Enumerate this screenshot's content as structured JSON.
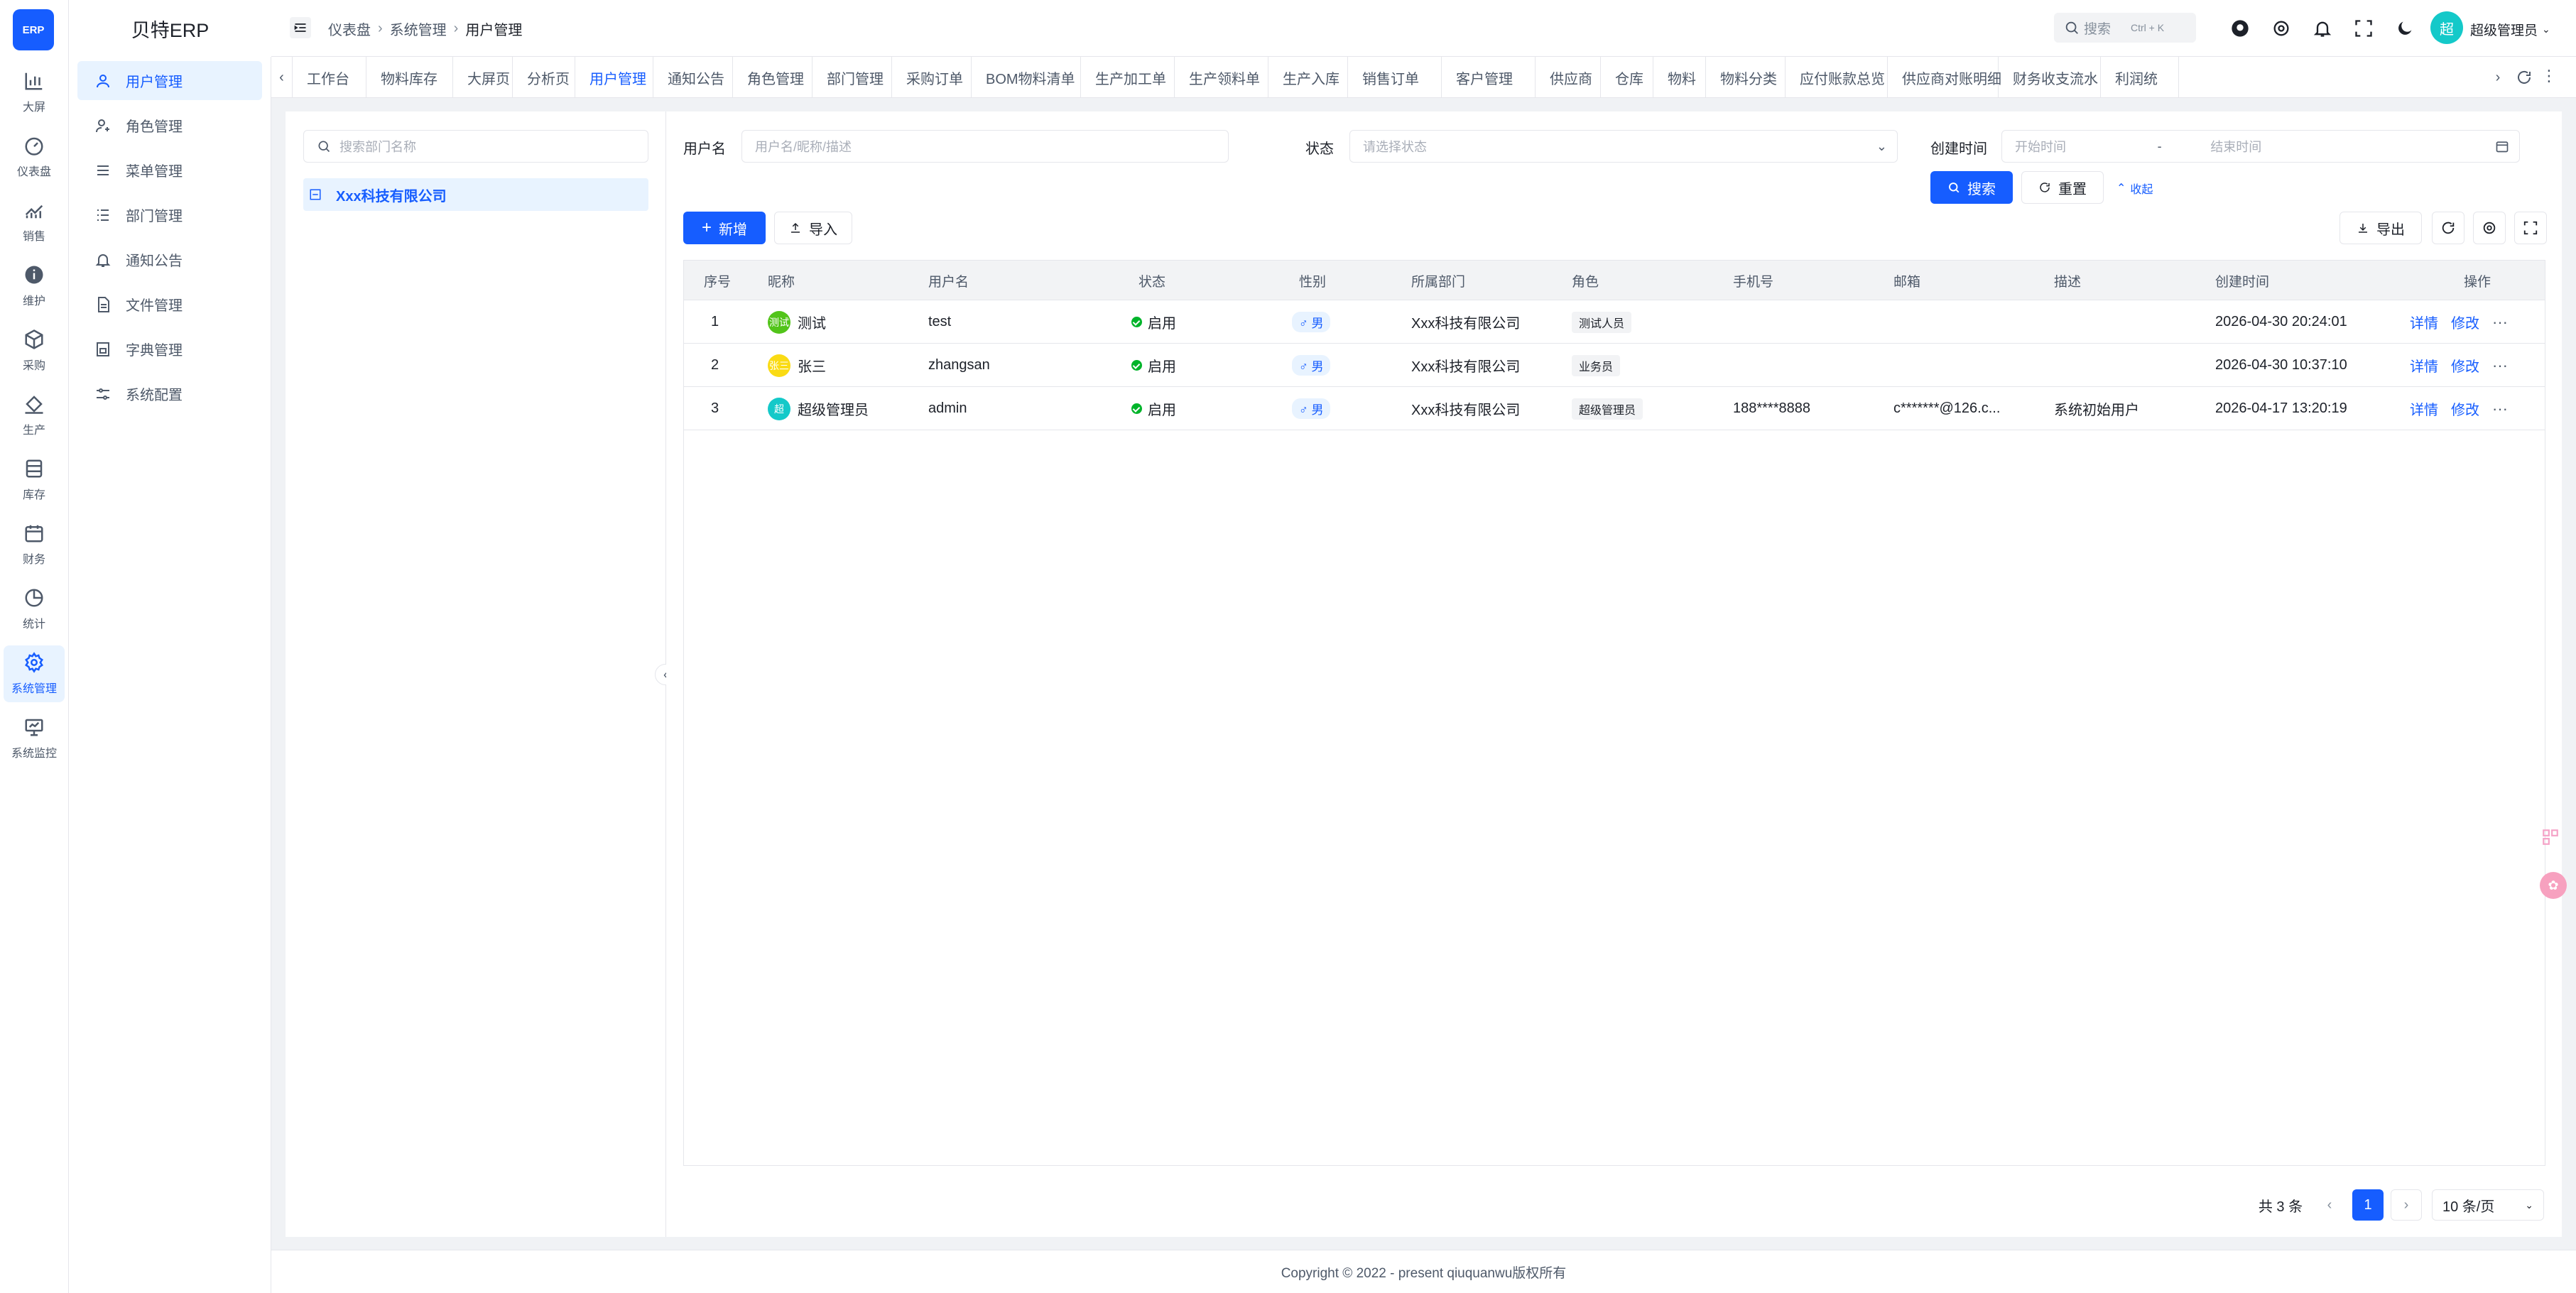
{
  "app": {
    "logo_text": "ERP",
    "title": "贝特ERP"
  },
  "rail": [
    {
      "label": "大屏",
      "icon": "bar-chart-icon"
    },
    {
      "label": "仪表盘",
      "icon": "dashboard-icon"
    },
    {
      "label": "销售",
      "icon": "trend-icon"
    },
    {
      "label": "维护",
      "icon": "info-icon"
    },
    {
      "label": "采购",
      "icon": "cube-icon"
    },
    {
      "label": "生产",
      "icon": "paint-bucket-icon"
    },
    {
      "label": "库存",
      "icon": "storage-icon"
    },
    {
      "label": "财务",
      "icon": "calendar-icon"
    },
    {
      "label": "统计",
      "icon": "pie-chart-icon"
    },
    {
      "label": "系统管理",
      "icon": "settings-icon"
    },
    {
      "label": "系统监控",
      "icon": "monitor-icon"
    }
  ],
  "submenu": [
    {
      "label": "用户管理"
    },
    {
      "label": "角色管理"
    },
    {
      "label": "菜单管理"
    },
    {
      "label": "部门管理"
    },
    {
      "label": "通知公告"
    },
    {
      "label": "文件管理"
    },
    {
      "label": "字典管理"
    },
    {
      "label": "系统配置"
    }
  ],
  "header": {
    "breadcrumb": [
      "仪表盘",
      "系统管理",
      "用户管理"
    ],
    "search_placeholder": "搜索",
    "search_shortcut": "Ctrl + K",
    "avatar_text": "超",
    "username": "超级管理员"
  },
  "tabs": [
    "工作台",
    "物料库存",
    "大屏页",
    "分析页",
    "用户管理",
    "通知公告",
    "角色管理",
    "部门管理",
    "采购订单",
    "BOM物料清单",
    "生产加工单",
    "生产领料单",
    "生产入库",
    "销售订单",
    "客户管理",
    "供应商",
    "仓库",
    "物料",
    "物料分类",
    "应付账款总览",
    "供应商对账明细",
    "财务收支流水",
    "利润统"
  ],
  "dept": {
    "search_placeholder": "搜索部门名称",
    "tree_root": "Xxx科技有限公司"
  },
  "filters": {
    "username_label": "用户名",
    "username_placeholder": "用户名/昵称/描述",
    "status_label": "状态",
    "status_placeholder": "请选择状态",
    "created_label": "创建时间",
    "start_placeholder": "开始时间",
    "range_sep": "-",
    "end_placeholder": "结束时间",
    "search_btn": "搜索",
    "reset_btn": "重置",
    "collapse_btn": "收起"
  },
  "toolbar": {
    "add_btn": "新增",
    "import_btn": "导入",
    "export_btn": "导出"
  },
  "table": {
    "columns": [
      "序号",
      "昵称",
      "用户名",
      "状态",
      "性别",
      "所属部门",
      "角色",
      "手机号",
      "邮箱",
      "描述",
      "创建时间",
      "操作"
    ],
    "rows": [
      {
        "index": "1",
        "avatar": "测试",
        "avatar_color": "#52c41a",
        "nickname": "测试",
        "username": "test",
        "status": "启用",
        "gender": "♂ 男",
        "dept": "Xxx科技有限公司",
        "role": "测试人员",
        "phone": "",
        "email": "",
        "desc": "",
        "created": "2026-04-30 20:24:01",
        "detail": "详情",
        "edit": "修改"
      },
      {
        "index": "2",
        "avatar": "张三",
        "avatar_color": "#fadb14",
        "nickname": "张三",
        "username": "zhangsan",
        "status": "启用",
        "gender": "♂ 男",
        "dept": "Xxx科技有限公司",
        "role": "业务员",
        "phone": "",
        "email": "",
        "desc": "",
        "created": "2026-04-30 10:37:10",
        "detail": "详情",
        "edit": "修改"
      },
      {
        "index": "3",
        "avatar": "超",
        "avatar_color": "#14c9c9",
        "nickname": "超级管理员",
        "username": "admin",
        "status": "启用",
        "gender": "♂ 男",
        "dept": "Xxx科技有限公司",
        "role": "超级管理员",
        "phone": "188****8888",
        "email": "c*******@126.c...",
        "desc": "系统初始用户",
        "created": "2026-04-17 13:20:19",
        "detail": "详情",
        "edit": "修改"
      }
    ]
  },
  "pagination": {
    "total": "共 3 条",
    "current": "1",
    "page_size": "10 条/页"
  },
  "footer": "Copyright © 2022 - present qiuquanwu版权所有"
}
